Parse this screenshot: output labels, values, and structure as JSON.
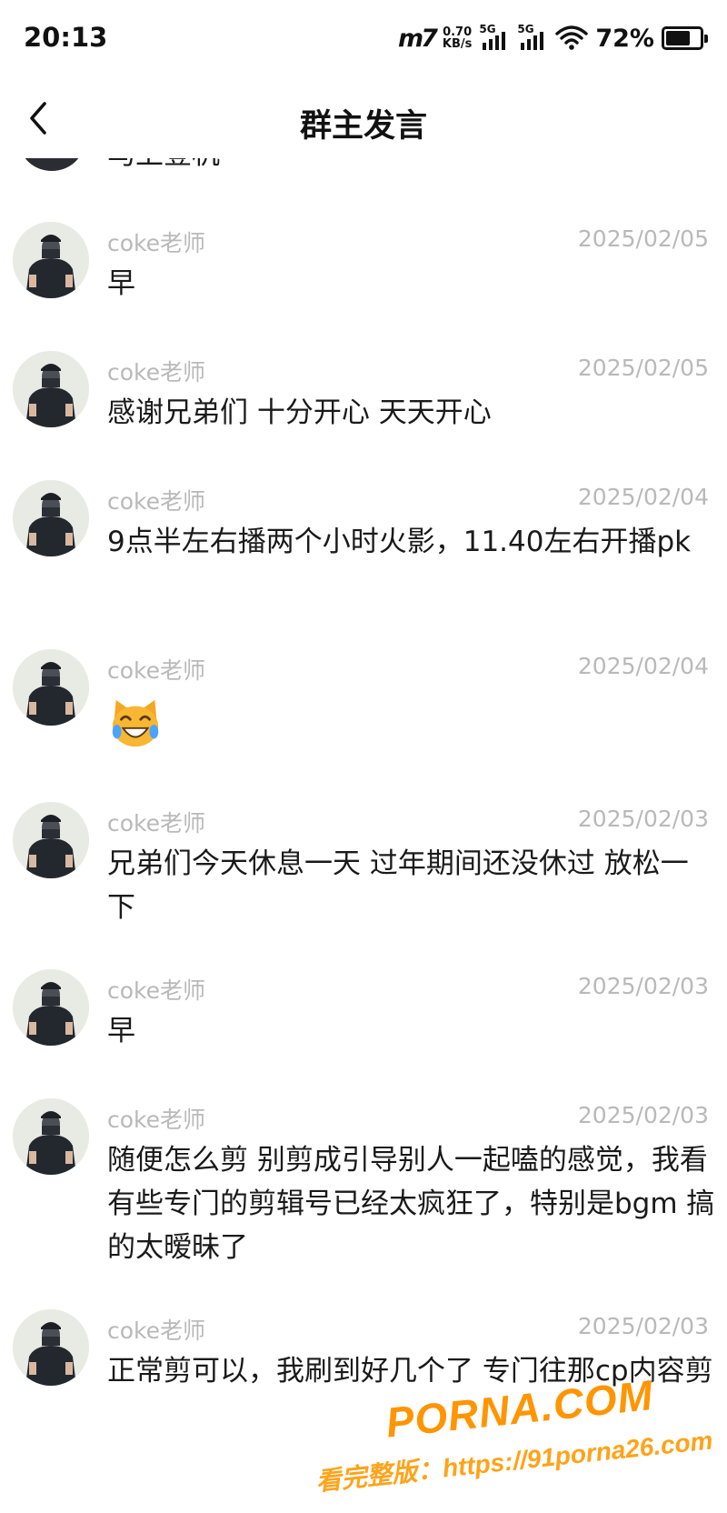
{
  "status_bar": {
    "time": "20:13",
    "carrier_logo": "m7",
    "net_speed_value": "0.70",
    "net_speed_unit": "KB/s",
    "signal_1_label": "5G",
    "signal_2_label": "5G",
    "battery_percent": "72%",
    "battery_level": 0.72
  },
  "nav": {
    "back_icon": "chevron-left-icon",
    "title": "群主发言"
  },
  "partial_message": {
    "text": "马上登机"
  },
  "messages": [
    {
      "name": "coke老师",
      "date": "2025/02/05",
      "text": "早"
    },
    {
      "name": "coke老师",
      "date": "2025/02/05",
      "text": "感谢兄弟们 十分开心 天天开心"
    },
    {
      "name": "coke老师",
      "date": "2025/02/04",
      "text": "9点半左右播两个小时火影，11.40左右开播pk"
    },
    {
      "name": "coke老师",
      "date": "2025/02/04",
      "text": "",
      "emoji": "cat-joy-emoji"
    },
    {
      "name": "coke老师",
      "date": "2025/02/03",
      "text": "兄弟们今天休息一天 过年期间还没休过 放松一下"
    },
    {
      "name": "coke老师",
      "date": "2025/02/03",
      "text": "早"
    },
    {
      "name": "coke老师",
      "date": "2025/02/03",
      "text": "随便怎么剪 别剪成引导别人一起嗑的感觉，我看有些专门的剪辑号已经太疯狂了，特别是bgm 搞的太暧昧了"
    },
    {
      "name": "coke老师",
      "date": "2025/02/03",
      "text": "正常剪可以，我刷到好几个了 专门往那cp内容剪"
    }
  ],
  "watermark": {
    "brand": "PORNA.COM",
    "url_line": "看完整版：https://91porna26.com"
  },
  "colors": {
    "meta_text": "#b9b9b9",
    "body_text": "#1a1a1a",
    "watermark": "#ff9500"
  }
}
